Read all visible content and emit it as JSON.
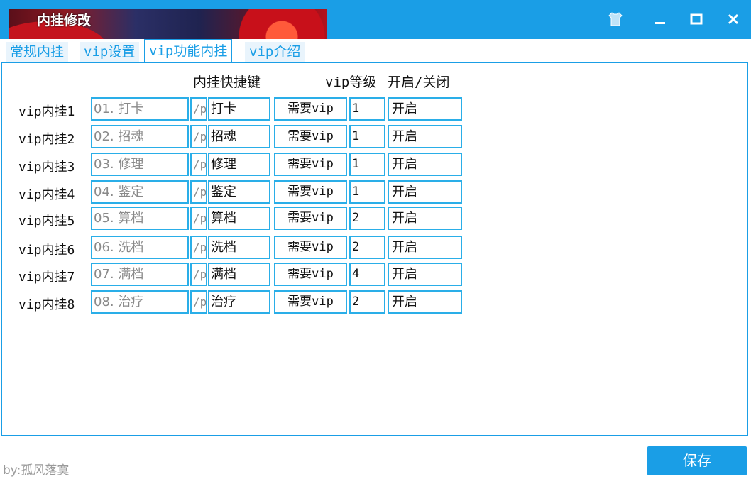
{
  "window": {
    "title": "内挂修改"
  },
  "tabs": [
    {
      "label": "常规内挂"
    },
    {
      "label": "vip设置"
    },
    {
      "label": "vip功能内挂"
    },
    {
      "label": "vip介绍"
    }
  ],
  "header": {
    "hotkey": "内挂快捷键",
    "vip_level": "vip等级",
    "toggle": "开启/关闭"
  },
  "rows": [
    {
      "label": "vip内挂1",
      "name": "01. 打卡",
      "prefix": "/p",
      "key": "打卡",
      "need": "需要vip",
      "level": "1",
      "status": "开启"
    },
    {
      "label": "vip内挂2",
      "name": "02. 招魂",
      "prefix": "/p",
      "key": "招魂",
      "need": "需要vip",
      "level": "1",
      "status": "开启"
    },
    {
      "label": "vip内挂3",
      "name": "03. 修理",
      "prefix": "/p",
      "key": "修理",
      "need": "需要vip",
      "level": "1",
      "status": "开启"
    },
    {
      "label": "vip内挂4",
      "name": "04. 鉴定",
      "prefix": "/p",
      "key": "鉴定",
      "need": "需要vip",
      "level": "1",
      "status": "开启"
    },
    {
      "label": "vip内挂5",
      "name": "05. 算档",
      "prefix": "/p",
      "key": "算档",
      "need": "需要vip",
      "level": "2",
      "status": "开启"
    },
    {
      "label": "vip内挂6",
      "name": "06. 洗档",
      "prefix": "/p",
      "key": "洗档",
      "need": "需要vip",
      "level": "2",
      "status": "开启"
    },
    {
      "label": "vip内挂7",
      "name": "07. 满档",
      "prefix": "/p",
      "key": "满档",
      "need": "需要vip",
      "level": "4",
      "status": "开启"
    },
    {
      "label": "vip内挂8",
      "name": "08. 治疗",
      "prefix": "/p",
      "key": "治疗",
      "need": "需要vip",
      "level": "2",
      "status": "开启"
    }
  ],
  "footer": {
    "credit": "by:孤风落寞",
    "save_label": "保存"
  },
  "icons": {
    "skin": "shirt-icon",
    "minimize": "minimize-icon",
    "maximize": "maximize-icon",
    "close": "close-icon"
  },
  "colors": {
    "accent": "#1a9ee6",
    "field_border": "#2aaee8"
  }
}
